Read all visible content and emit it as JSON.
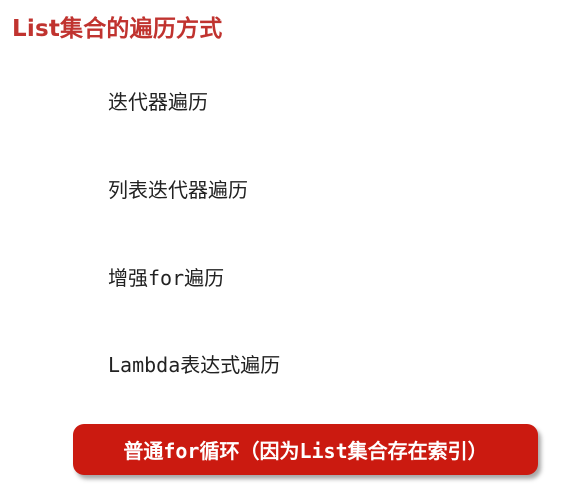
{
  "title": "List集合的遍历方式",
  "items": [
    "迭代器遍历",
    "列表迭代器遍历",
    "增强for遍历",
    "Lambda表达式遍历"
  ],
  "highlight": "普通for循环（因为List集合存在索引）",
  "colors": {
    "title": "#c0332f",
    "highlight_bg": "#cb1a10",
    "highlight_text": "#ffffff",
    "item_text": "#222222"
  }
}
